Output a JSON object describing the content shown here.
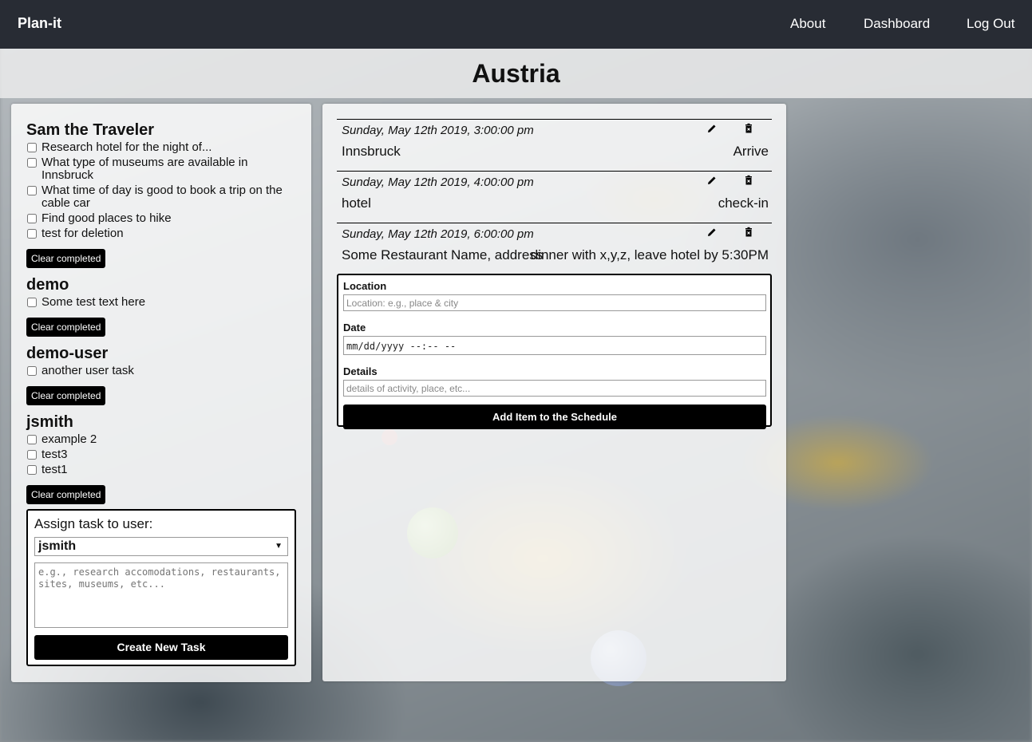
{
  "nav": {
    "brand": "Plan-it",
    "links": [
      "About",
      "Dashboard",
      "Log Out"
    ]
  },
  "page_title": "Austria",
  "users": [
    {
      "name": "Sam the Traveler",
      "tasks": [
        "Research hotel for the night of...",
        "What type of museums are available in Innsbruck",
        "What time of day is good to book a trip on the cable car",
        "Find good places to hike",
        "test for deletion"
      ]
    },
    {
      "name": "demo",
      "tasks": [
        "Some test text here"
      ]
    },
    {
      "name": "demo-user",
      "tasks": [
        "another user task"
      ]
    },
    {
      "name": "jsmith",
      "tasks": [
        "example 2",
        "test3",
        "test1"
      ]
    }
  ],
  "clear_label": "Clear completed",
  "assign": {
    "label": "Assign task to user:",
    "selected_user": "jsmith",
    "placeholder": "e.g., research accomodations, restaurants, sites, museums, etc...",
    "create_label": "Create New Task"
  },
  "schedule": [
    {
      "date": "Sunday, May 12th 2019, 3:00:00 pm",
      "location": "Innsbruck",
      "details": "Arrive"
    },
    {
      "date": "Sunday, May 12th 2019, 4:00:00 pm",
      "location": "hotel",
      "details": "check-in"
    },
    {
      "date": "Sunday, May 12th 2019, 6:00:00 pm",
      "location": "Some Restaurant Name, address",
      "details": "dinner with x,y,z, leave hotel by 5:30PM"
    }
  ],
  "schedule_form": {
    "location_label": "Location",
    "location_placeholder": "Location: e.g., place & city",
    "date_label": "Date",
    "date_placeholder": "mm/dd/yyyy --:-- --",
    "details_label": "Details",
    "details_placeholder": "details of activity, place, etc...",
    "add_label": "Add Item to the Schedule"
  },
  "icons": {
    "edit": "pencil-icon",
    "delete": "trash-icon"
  },
  "colors": {
    "navbar": "#282c34",
    "button": "#000000",
    "panel": "#ffffff"
  }
}
